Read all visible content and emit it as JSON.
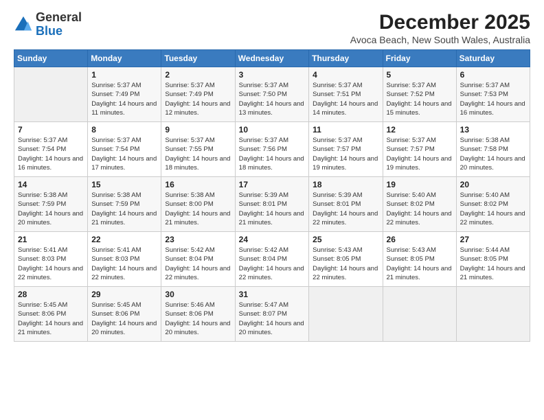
{
  "header": {
    "logo_general": "General",
    "logo_blue": "Blue",
    "month_title": "December 2025",
    "location": "Avoca Beach, New South Wales, Australia"
  },
  "weekdays": [
    "Sunday",
    "Monday",
    "Tuesday",
    "Wednesday",
    "Thursday",
    "Friday",
    "Saturday"
  ],
  "weeks": [
    [
      {
        "day": "",
        "empty": true
      },
      {
        "day": "1",
        "sunrise": "Sunrise: 5:37 AM",
        "sunset": "Sunset: 7:49 PM",
        "daylight": "Daylight: 14 hours and 11 minutes."
      },
      {
        "day": "2",
        "sunrise": "Sunrise: 5:37 AM",
        "sunset": "Sunset: 7:49 PM",
        "daylight": "Daylight: 14 hours and 12 minutes."
      },
      {
        "day": "3",
        "sunrise": "Sunrise: 5:37 AM",
        "sunset": "Sunset: 7:50 PM",
        "daylight": "Daylight: 14 hours and 13 minutes."
      },
      {
        "day": "4",
        "sunrise": "Sunrise: 5:37 AM",
        "sunset": "Sunset: 7:51 PM",
        "daylight": "Daylight: 14 hours and 14 minutes."
      },
      {
        "day": "5",
        "sunrise": "Sunrise: 5:37 AM",
        "sunset": "Sunset: 7:52 PM",
        "daylight": "Daylight: 14 hours and 15 minutes."
      },
      {
        "day": "6",
        "sunrise": "Sunrise: 5:37 AM",
        "sunset": "Sunset: 7:53 PM",
        "daylight": "Daylight: 14 hours and 16 minutes."
      }
    ],
    [
      {
        "day": "7",
        "sunrise": "Sunrise: 5:37 AM",
        "sunset": "Sunset: 7:54 PM",
        "daylight": "Daylight: 14 hours and 16 minutes."
      },
      {
        "day": "8",
        "sunrise": "Sunrise: 5:37 AM",
        "sunset": "Sunset: 7:54 PM",
        "daylight": "Daylight: 14 hours and 17 minutes."
      },
      {
        "day": "9",
        "sunrise": "Sunrise: 5:37 AM",
        "sunset": "Sunset: 7:55 PM",
        "daylight": "Daylight: 14 hours and 18 minutes."
      },
      {
        "day": "10",
        "sunrise": "Sunrise: 5:37 AM",
        "sunset": "Sunset: 7:56 PM",
        "daylight": "Daylight: 14 hours and 18 minutes."
      },
      {
        "day": "11",
        "sunrise": "Sunrise: 5:37 AM",
        "sunset": "Sunset: 7:57 PM",
        "daylight": "Daylight: 14 hours and 19 minutes."
      },
      {
        "day": "12",
        "sunrise": "Sunrise: 5:37 AM",
        "sunset": "Sunset: 7:57 PM",
        "daylight": "Daylight: 14 hours and 19 minutes."
      },
      {
        "day": "13",
        "sunrise": "Sunrise: 5:38 AM",
        "sunset": "Sunset: 7:58 PM",
        "daylight": "Daylight: 14 hours and 20 minutes."
      }
    ],
    [
      {
        "day": "14",
        "sunrise": "Sunrise: 5:38 AM",
        "sunset": "Sunset: 7:59 PM",
        "daylight": "Daylight: 14 hours and 20 minutes."
      },
      {
        "day": "15",
        "sunrise": "Sunrise: 5:38 AM",
        "sunset": "Sunset: 7:59 PM",
        "daylight": "Daylight: 14 hours and 21 minutes."
      },
      {
        "day": "16",
        "sunrise": "Sunrise: 5:38 AM",
        "sunset": "Sunset: 8:00 PM",
        "daylight": "Daylight: 14 hours and 21 minutes."
      },
      {
        "day": "17",
        "sunrise": "Sunrise: 5:39 AM",
        "sunset": "Sunset: 8:01 PM",
        "daylight": "Daylight: 14 hours and 21 minutes."
      },
      {
        "day": "18",
        "sunrise": "Sunrise: 5:39 AM",
        "sunset": "Sunset: 8:01 PM",
        "daylight": "Daylight: 14 hours and 22 minutes."
      },
      {
        "day": "19",
        "sunrise": "Sunrise: 5:40 AM",
        "sunset": "Sunset: 8:02 PM",
        "daylight": "Daylight: 14 hours and 22 minutes."
      },
      {
        "day": "20",
        "sunrise": "Sunrise: 5:40 AM",
        "sunset": "Sunset: 8:02 PM",
        "daylight": "Daylight: 14 hours and 22 minutes."
      }
    ],
    [
      {
        "day": "21",
        "sunrise": "Sunrise: 5:41 AM",
        "sunset": "Sunset: 8:03 PM",
        "daylight": "Daylight: 14 hours and 22 minutes."
      },
      {
        "day": "22",
        "sunrise": "Sunrise: 5:41 AM",
        "sunset": "Sunset: 8:03 PM",
        "daylight": "Daylight: 14 hours and 22 minutes."
      },
      {
        "day": "23",
        "sunrise": "Sunrise: 5:42 AM",
        "sunset": "Sunset: 8:04 PM",
        "daylight": "Daylight: 14 hours and 22 minutes."
      },
      {
        "day": "24",
        "sunrise": "Sunrise: 5:42 AM",
        "sunset": "Sunset: 8:04 PM",
        "daylight": "Daylight: 14 hours and 22 minutes."
      },
      {
        "day": "25",
        "sunrise": "Sunrise: 5:43 AM",
        "sunset": "Sunset: 8:05 PM",
        "daylight": "Daylight: 14 hours and 22 minutes."
      },
      {
        "day": "26",
        "sunrise": "Sunrise: 5:43 AM",
        "sunset": "Sunset: 8:05 PM",
        "daylight": "Daylight: 14 hours and 21 minutes."
      },
      {
        "day": "27",
        "sunrise": "Sunrise: 5:44 AM",
        "sunset": "Sunset: 8:05 PM",
        "daylight": "Daylight: 14 hours and 21 minutes."
      }
    ],
    [
      {
        "day": "28",
        "sunrise": "Sunrise: 5:45 AM",
        "sunset": "Sunset: 8:06 PM",
        "daylight": "Daylight: 14 hours and 21 minutes."
      },
      {
        "day": "29",
        "sunrise": "Sunrise: 5:45 AM",
        "sunset": "Sunset: 8:06 PM",
        "daylight": "Daylight: 14 hours and 20 minutes."
      },
      {
        "day": "30",
        "sunrise": "Sunrise: 5:46 AM",
        "sunset": "Sunset: 8:06 PM",
        "daylight": "Daylight: 14 hours and 20 minutes."
      },
      {
        "day": "31",
        "sunrise": "Sunrise: 5:47 AM",
        "sunset": "Sunset: 8:07 PM",
        "daylight": "Daylight: 14 hours and 20 minutes."
      },
      {
        "day": "",
        "empty": true
      },
      {
        "day": "",
        "empty": true
      },
      {
        "day": "",
        "empty": true
      }
    ]
  ]
}
